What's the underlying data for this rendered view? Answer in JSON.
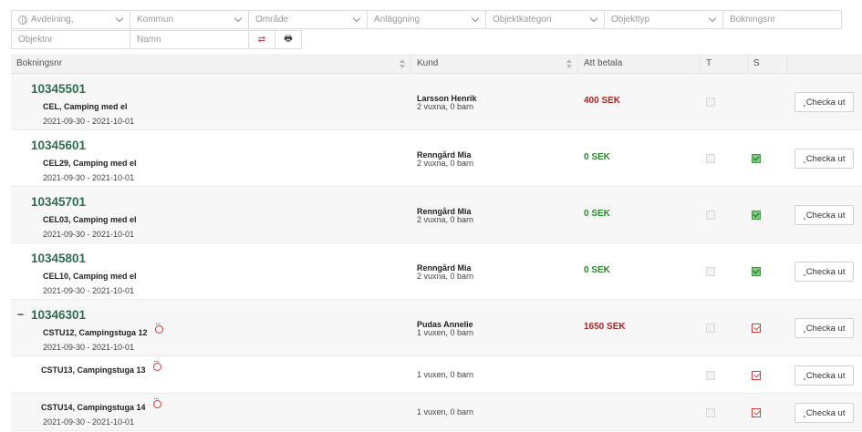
{
  "filters": {
    "row1": [
      "Avdelning,",
      "Kommun",
      "Område",
      "Anläggning",
      "Objektkategori",
      "Objekttyp",
      "Bokningsnr"
    ],
    "row2": [
      "Objektnr",
      "Namn"
    ],
    "clear_icon": "⇄",
    "print_icon": "🖶"
  },
  "table": {
    "headers": [
      "Bokningsnr",
      "Kund",
      "Att betala",
      "T",
      "S",
      ""
    ],
    "checkout_label": "¸Checka ut"
  },
  "bookings": [
    {
      "number": "10345501",
      "object": "CEL, Camping med el",
      "dates": "2021-09-30 - 2021-10-01",
      "customer": "Larsson Henrik",
      "guests": "2 vuxna, 0 barn",
      "amount": "400 SEK",
      "amount_status": "due",
      "t_checked": false,
      "s_state": "none",
      "row_alt": true
    },
    {
      "number": "10345601",
      "object": "CEL29, Camping med el",
      "dates": "2021-09-30 - 2021-10-01",
      "customer": "Renngård Mia",
      "guests": "2 vuxna, 0 barn",
      "amount": "0 SEK",
      "amount_status": "paid",
      "t_checked": false,
      "s_state": "green",
      "row_alt": false
    },
    {
      "number": "10345701",
      "object": "CEL03, Camping med el",
      "dates": "2021-09-30 - 2021-10-01",
      "customer": "Renngård Mia",
      "guests": "2 vuxna, 0 barn",
      "amount": "0 SEK",
      "amount_status": "paid",
      "t_checked": false,
      "s_state": "green",
      "row_alt": true
    },
    {
      "number": "10345801",
      "object": "CEL10, Camping med el",
      "dates": "2021-09-30 - 2021-10-01",
      "customer": "Renngård Mia",
      "guests": "2 vuxna, 0 barn",
      "amount": "0 SEK",
      "amount_status": "paid",
      "t_checked": false,
      "s_state": "green",
      "row_alt": false
    },
    {
      "number": "10346301",
      "object": "CSTU12, Campingstuga 12",
      "dates": "2021-09-30 - 2021-10-01",
      "customer": "Pudas Annelie",
      "guests": "1 vuxen, 0 barn",
      "amount": "1650 SEK",
      "amount_status": "due",
      "t_checked": false,
      "s_state": "red",
      "row_alt": true,
      "collapse": "−",
      "comment": true
    },
    {
      "number": "",
      "object": "CSTU13, Campingstuga 13",
      "dates": "",
      "customer": "",
      "guests": "1 vuxen, 0 barn",
      "amount": "",
      "amount_status": "",
      "t_checked": false,
      "s_state": "red",
      "row_alt": false,
      "comment": true,
      "nested": true
    },
    {
      "number": "",
      "object": "CSTU14, Campingstuga 14",
      "dates": "2021-09-30 - 2021-10-01",
      "customer": "",
      "guests": "1 vuxen, 0 barn",
      "amount": "",
      "amount_status": "",
      "t_checked": false,
      "s_state": "red",
      "row_alt": true,
      "comment": true,
      "nested": true
    }
  ]
}
